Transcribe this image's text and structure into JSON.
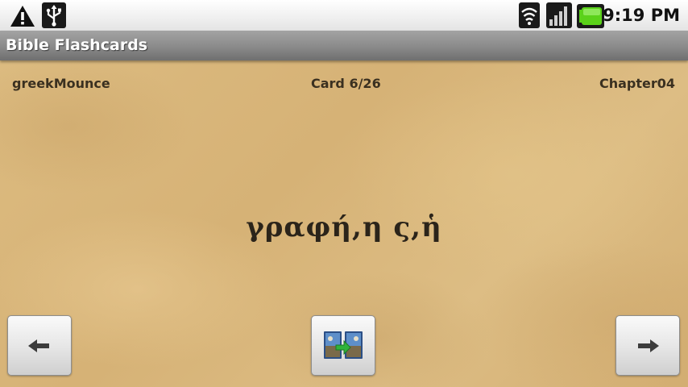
{
  "status_bar": {
    "time": "9:19 PM",
    "icons": [
      "warning-icon",
      "usb-icon",
      "wifi-icon",
      "signal-icon",
      "battery-icon"
    ],
    "battery_color": "#5bd21a"
  },
  "app": {
    "title": "Bible Flashcards"
  },
  "card": {
    "deck_name": "greekMounce",
    "counter": "Card 6/26",
    "chapter": "Chapter04",
    "term": "γραφή,η ς,ἡ"
  },
  "buttons": {
    "prev_icon": "left-arrow-icon",
    "flip_icon": "flip-card-icon",
    "next_icon": "right-arrow-icon"
  },
  "colors": {
    "title_bar": "#8a8a8a",
    "parchment": "#d9b77c",
    "text": "#3a3020"
  }
}
